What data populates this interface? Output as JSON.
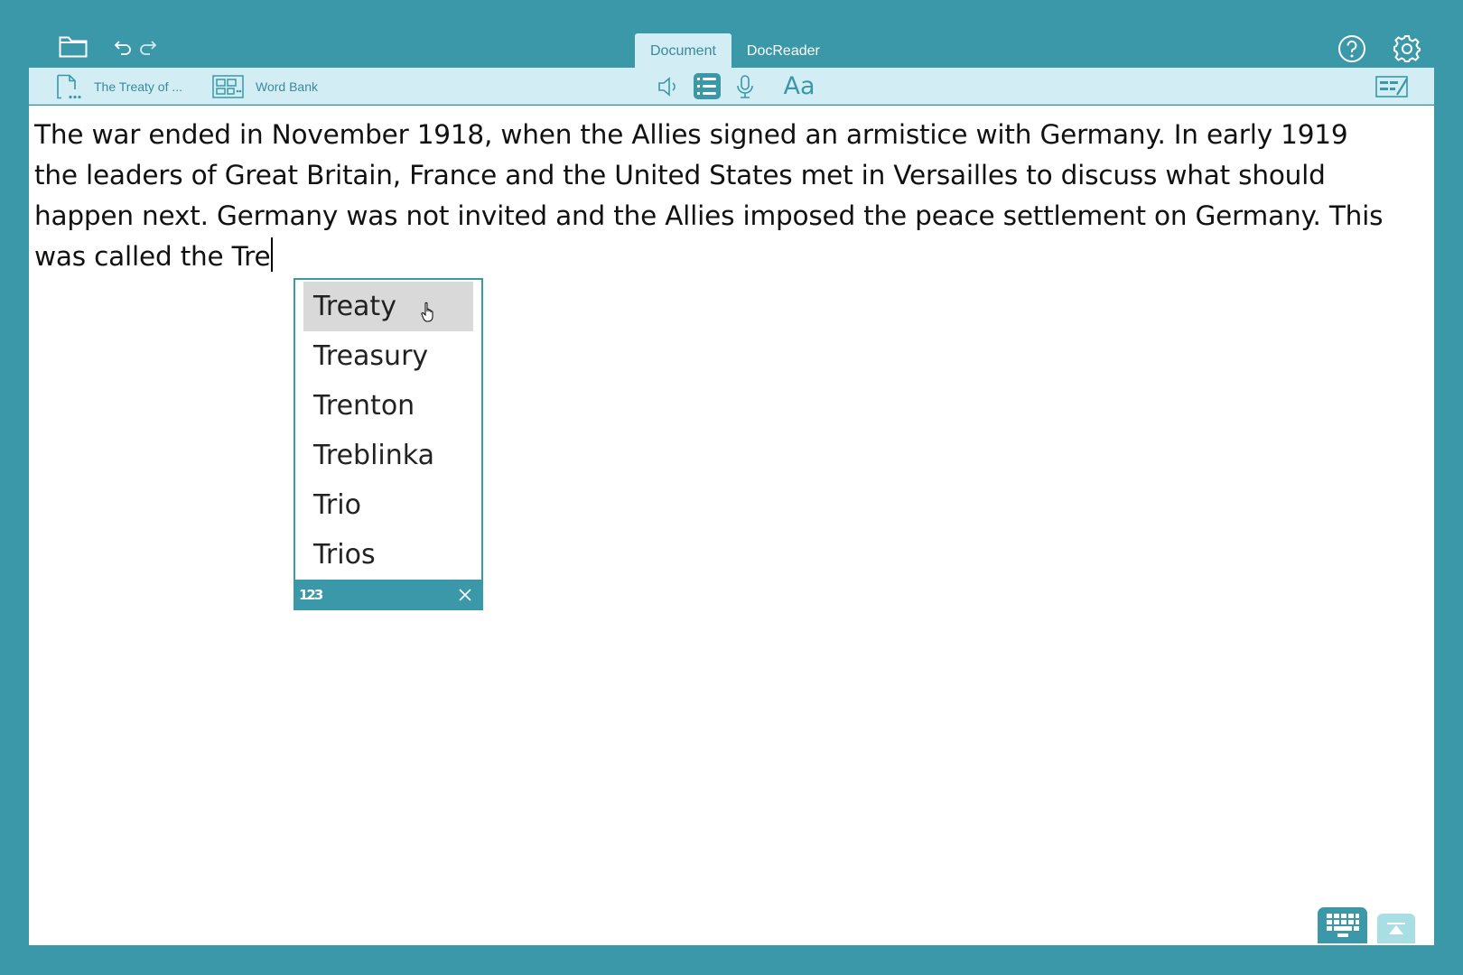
{
  "header": {
    "tabs": [
      {
        "label": "Document",
        "active": true
      },
      {
        "label": "DocReader",
        "active": false
      }
    ],
    "icons": [
      "folder-icon",
      "undo-icon",
      "redo-icon",
      "help-icon",
      "gear-icon"
    ]
  },
  "toolbar": {
    "document_label": "The Treaty of ...",
    "wordbank_label": "Word Bank",
    "font_label": "Aa",
    "icons": [
      "document-icon",
      "word-bank-icon",
      "speaker-icon",
      "prediction-list-icon",
      "microphone-icon",
      "checklist-icon"
    ]
  },
  "document": {
    "lines": [
      "The war ended in November 1918, when the Allies signed an armistice with Germany. In early 1919",
      "the leaders of Great Britain, France and the United States met in Versailles to discuss what should",
      "happen next. Germany was not invited and the Allies imposed the peace settlement on Germany. This",
      "was called the Tre"
    ]
  },
  "prediction": {
    "suggestions": [
      "Treaty",
      "Treasury",
      "Trenton",
      "Treblinka",
      "Trio",
      "Trios"
    ],
    "highlighted_index": 0,
    "numbers_label": "123"
  },
  "colors": {
    "frame": "#3a98a8",
    "toolbar_bg": "#d3edf5",
    "accent": "#3a8a9a",
    "highlight": "#d9d9d9"
  }
}
